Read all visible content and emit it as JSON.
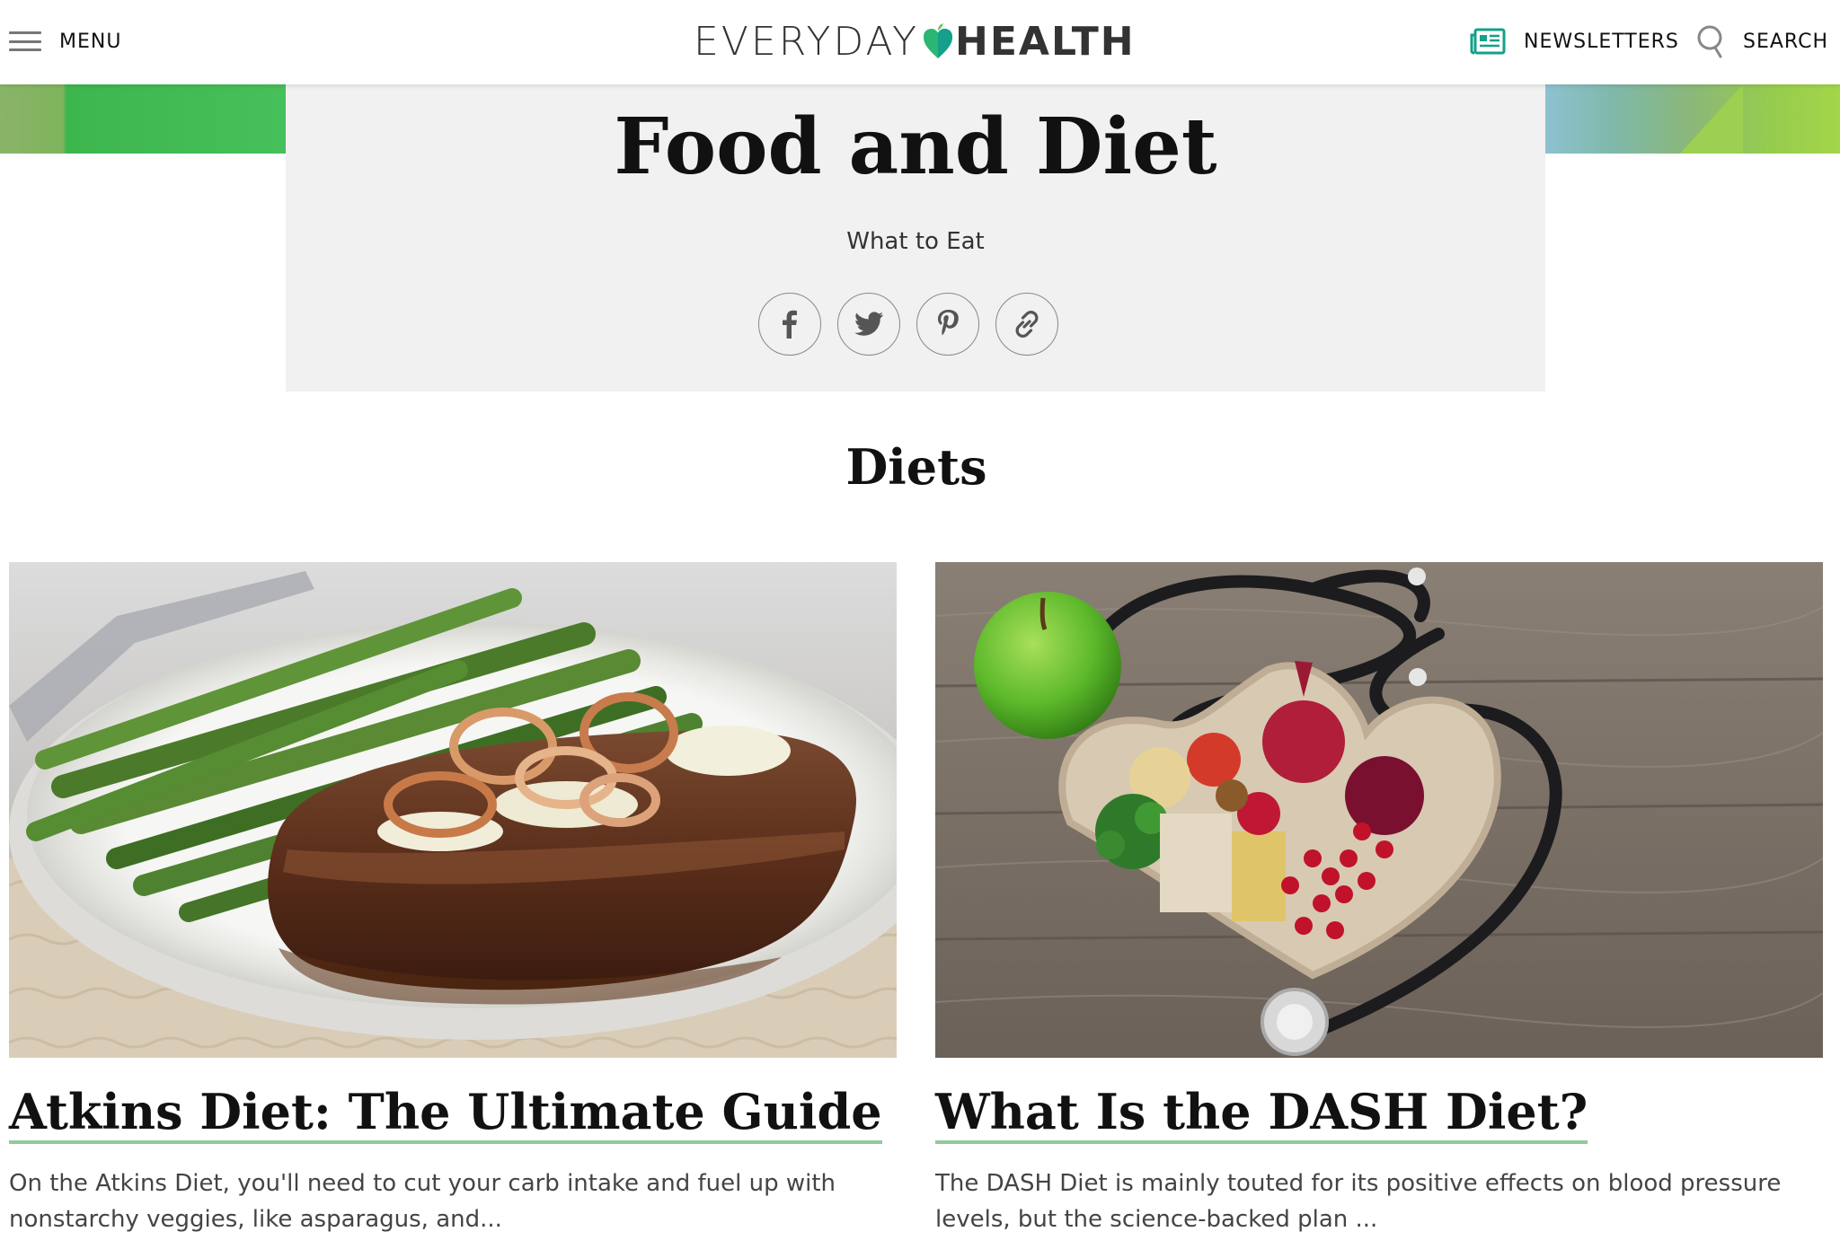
{
  "header": {
    "menu_label": "MENU",
    "logo_everyday": "EVERYDAY",
    "logo_health": "HEALTH",
    "newsletters_label": "NEWSLETTERS",
    "search_label": "SEARCH",
    "brand_color": "#14a08a",
    "heart_color": "#2bb673"
  },
  "hero": {
    "title": "Food and Diet",
    "subtitle": "What to Eat",
    "share_icons": [
      "facebook-icon",
      "twitter-icon",
      "pinterest-icon",
      "link-icon"
    ]
  },
  "section": {
    "title": "Diets"
  },
  "cards": [
    {
      "title": "Atkins Diet: The Ultimate Guide",
      "description": "On the Atkins Diet, you'll need to cut your carb intake and fuel up with nonstarchy veggies, like asparagus, and...",
      "image": "steak with onions and asparagus on a plate"
    },
    {
      "title": "What Is the DASH Diet?",
      "description": "The DASH Diet is mainly touted for its positive effects on blood pressure levels, but the science-backed plan ...",
      "image": "heart-shaped bowl of vegetables with stethoscope and apple"
    }
  ],
  "accent_underline_color": "#93c99a"
}
